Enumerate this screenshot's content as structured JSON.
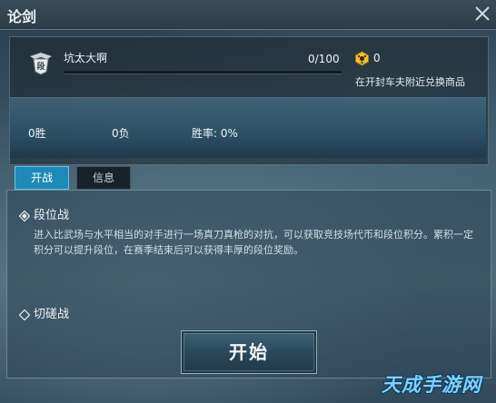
{
  "window": {
    "title": "论剑",
    "close_icon": "close-icon"
  },
  "player": {
    "name": "坑太大啊",
    "rank_badge_icon": "rank-badge-icon",
    "progress_text": "0/100",
    "progress_fraction": 0,
    "coin_icon": "arena-coin-icon",
    "coin_count": "0",
    "exchange_note": "在开封车夫附近兑换商品"
  },
  "stats": {
    "wins": "0胜",
    "losses": "0负",
    "win_rate": "胜率: 0%"
  },
  "tabs": [
    {
      "label": "开战",
      "active": true
    },
    {
      "label": "信息",
      "active": false
    }
  ],
  "modes": [
    {
      "label": "段位战",
      "selected": true,
      "description": "进入比武场与水平相当的对手进行一场真刀真枪的对抗，可以获取竞技场代币和段位积分。累积一定积分可以提升段位，在赛季结束后可以获得丰厚的段位奖励。"
    },
    {
      "label": "切磋战",
      "selected": false
    }
  ],
  "start_button": {
    "label": "开始"
  },
  "watermark": {
    "text": "天成手游网"
  },
  "colors": {
    "accent": "#1e8ab8",
    "progress": "#d8b24a",
    "coin": "#f2c22e"
  }
}
